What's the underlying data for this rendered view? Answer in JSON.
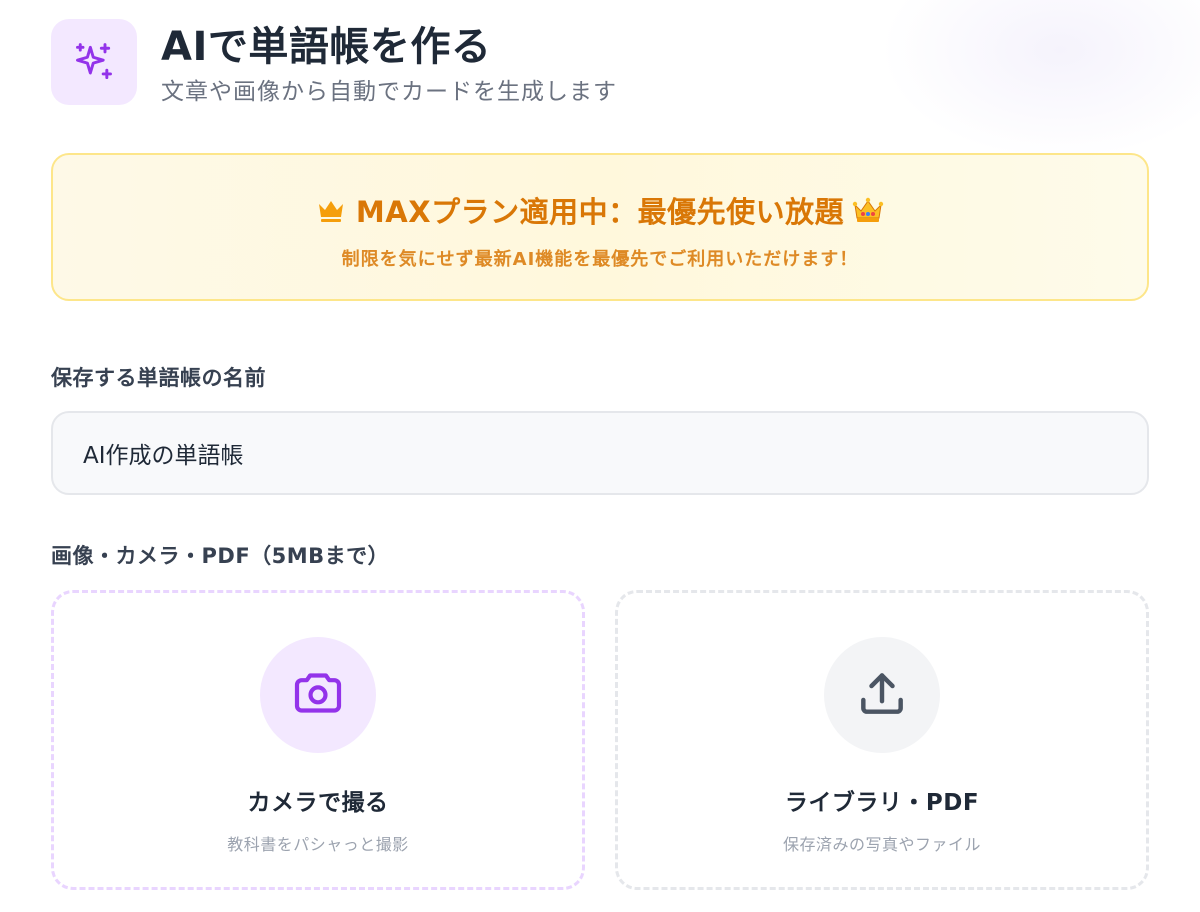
{
  "header": {
    "title": "AIで単語帳を作る",
    "subtitle": "文章や画像から自動でカードを生成します",
    "icon": "sparkles-icon"
  },
  "banner": {
    "title": "MAXプラン適用中：最優先使い放題",
    "subtitle": "制限を気にせず最新AI機能を最優先でご利用いただけます！",
    "icon_left": "crown-icon",
    "icon_right": "crown-emoji-icon"
  },
  "name_field": {
    "label": "保存する単語帳の名前",
    "value": "AI作成の単語帳"
  },
  "upload": {
    "label": "画像・カメラ・PDF（5MBまで）",
    "camera": {
      "title": "カメラで撮る",
      "subtitle": "教科書をパシャっと撮影",
      "icon": "camera-icon"
    },
    "library": {
      "title": "ライブラリ・PDF",
      "subtitle": "保存済みの写真やファイル",
      "icon": "upload-icon"
    }
  },
  "colors": {
    "accent_purple": "#9333ea",
    "banner_text": "#d97706",
    "banner_border": "#fde68a"
  }
}
